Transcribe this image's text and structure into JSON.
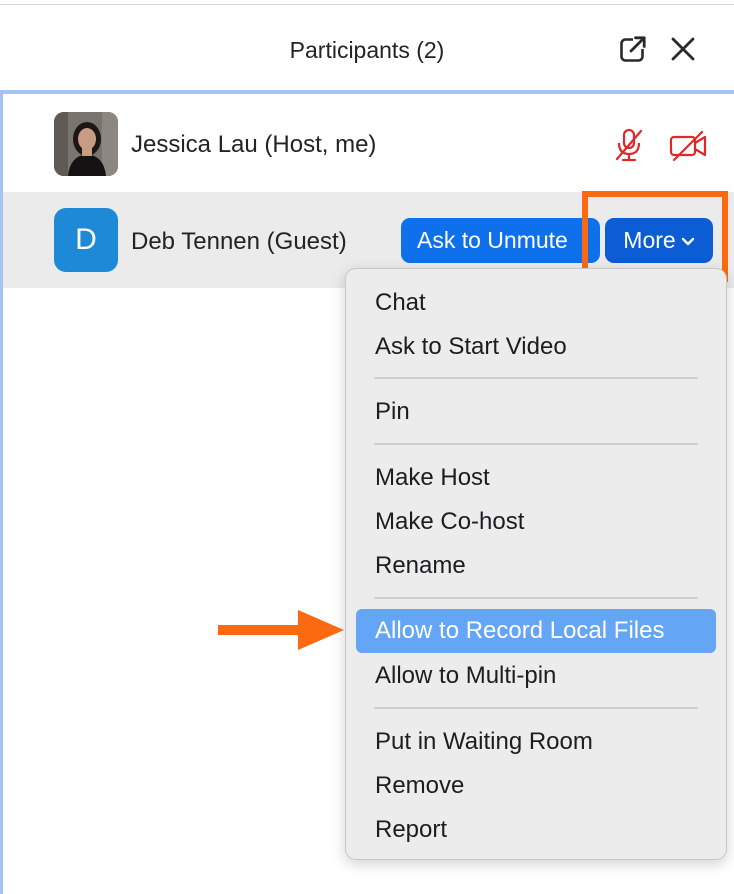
{
  "header": {
    "title": "Participants (2)"
  },
  "participants": [
    {
      "name": "Jessica Lau (Host, me)"
    },
    {
      "name": "Deb Tennen (Guest)",
      "initial": "D",
      "ask_label": "Ask to Unmute",
      "more_label": "More"
    }
  ],
  "menu": {
    "items": [
      "Chat",
      "Ask to Start Video",
      "Pin",
      "Make Host",
      "Make Co-host",
      "Rename",
      "Allow to Record Local Files",
      "Allow to Multi-pin",
      "Put in Waiting Room",
      "Remove",
      "Report"
    ],
    "highlighted": "Allow to Record Local Files"
  },
  "colors": {
    "accent_blue": "#0e71eb",
    "menu_highlight": "#64a6f5",
    "annotation_orange": "#fb6a10",
    "status_red": "#e02828"
  },
  "icons": [
    "popout-icon",
    "close-icon",
    "mic-muted-icon",
    "video-off-icon",
    "chevron-down-icon",
    "annotation-arrow"
  ]
}
